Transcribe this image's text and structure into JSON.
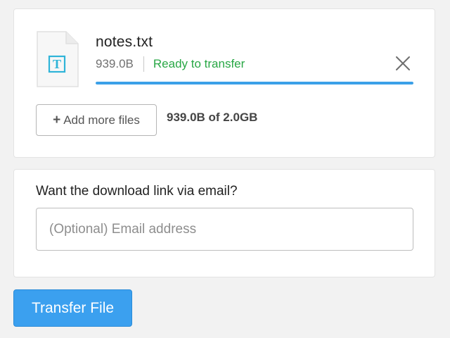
{
  "file": {
    "name": "notes.txt",
    "size": "939.0B",
    "status": "Ready to transfer",
    "icon_glyph": "T",
    "icon": "text-file-icon",
    "progress": 1.0
  },
  "actions": {
    "add_more_label": "Add more files",
    "add_more_icon": "plus-icon",
    "remove_icon": "close-icon",
    "transfer_label": "Transfer File"
  },
  "quota": {
    "text": "939.0B of 2.0GB"
  },
  "email": {
    "label": "Want the download link via email?",
    "placeholder": "(Optional) Email address",
    "value": ""
  },
  "colors": {
    "accent": "#3ba0ef",
    "status_ready": "#28a745",
    "file_icon": "#2fb4d8"
  }
}
